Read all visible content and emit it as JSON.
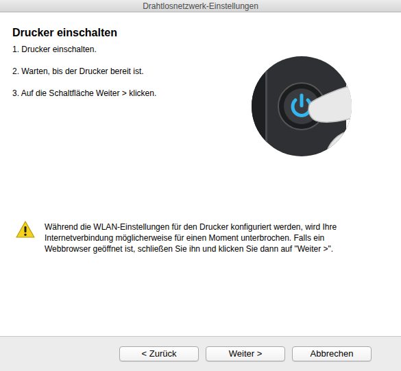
{
  "window": {
    "title": "Drahtlosnetzwerk-Einstellungen"
  },
  "heading": "Drucker einschalten",
  "steps": [
    "1. Drucker einschalten.",
    "2. Warten, bis der Drucker bereit ist.",
    "3. Auf die Schaltfläche Weiter > klicken."
  ],
  "warning": {
    "text": "Während die WLAN-Einstellungen für den Drucker konfiguriert werden, wird Ihre Internetverbindung möglicherweise für einen Moment unterbrochen. Falls ein Webbrowser geöffnet ist, schließen Sie ihn und klicken Sie dann auf \"Weiter >\"."
  },
  "buttons": [
    {
      "label": "< Zurück"
    },
    {
      "label": "Weiter >"
    },
    {
      "label": "Abbrechen"
    }
  ]
}
